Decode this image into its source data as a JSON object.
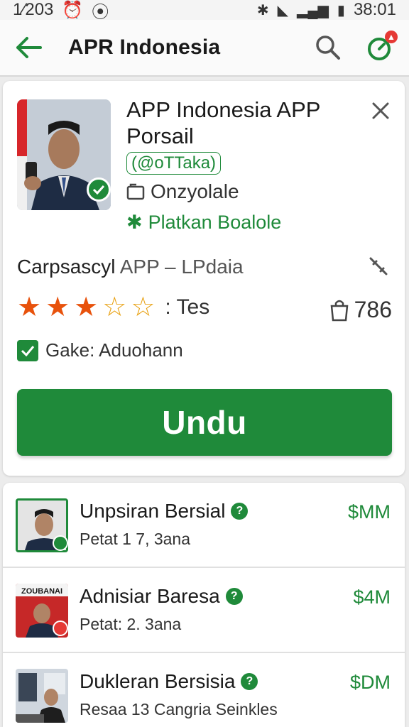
{
  "status_bar": {
    "left_text": "1⁄203",
    "time": "38:01"
  },
  "app_bar": {
    "title": "APR Indonesia"
  },
  "detail": {
    "name": "APP Indonesia APP Porsail",
    "handle": "(@oTTaka)",
    "meta_one": "Onzyolale",
    "meta_two": "Platkan Boalole",
    "subtitle_main": "Carpsascyl",
    "subtitle_rest": "APP – LPdaia",
    "rating_stars": 3,
    "rating_max": 5,
    "rating_label": ": Tes",
    "count": "786",
    "checkbox_label": "Gake: Aduohann",
    "download_label": "Undu"
  },
  "list": [
    {
      "title": "Unpsiran Bersial",
      "subtitle": "Petat 1 7, 3ana",
      "price": "$MM",
      "thumb_text": ""
    },
    {
      "title": "Adnisiar Baresa",
      "subtitle": "Petat:  2. 3ana",
      "price": "$4M",
      "thumb_text": "ZOUBANAI"
    },
    {
      "title": "Dukleran Bersisia",
      "subtitle": "Resaa 13 Cangria Seinkles",
      "price": "$DM",
      "thumb_text": ""
    }
  ],
  "colors": {
    "accent": "#1f8a3a",
    "star": "#e8520c"
  }
}
